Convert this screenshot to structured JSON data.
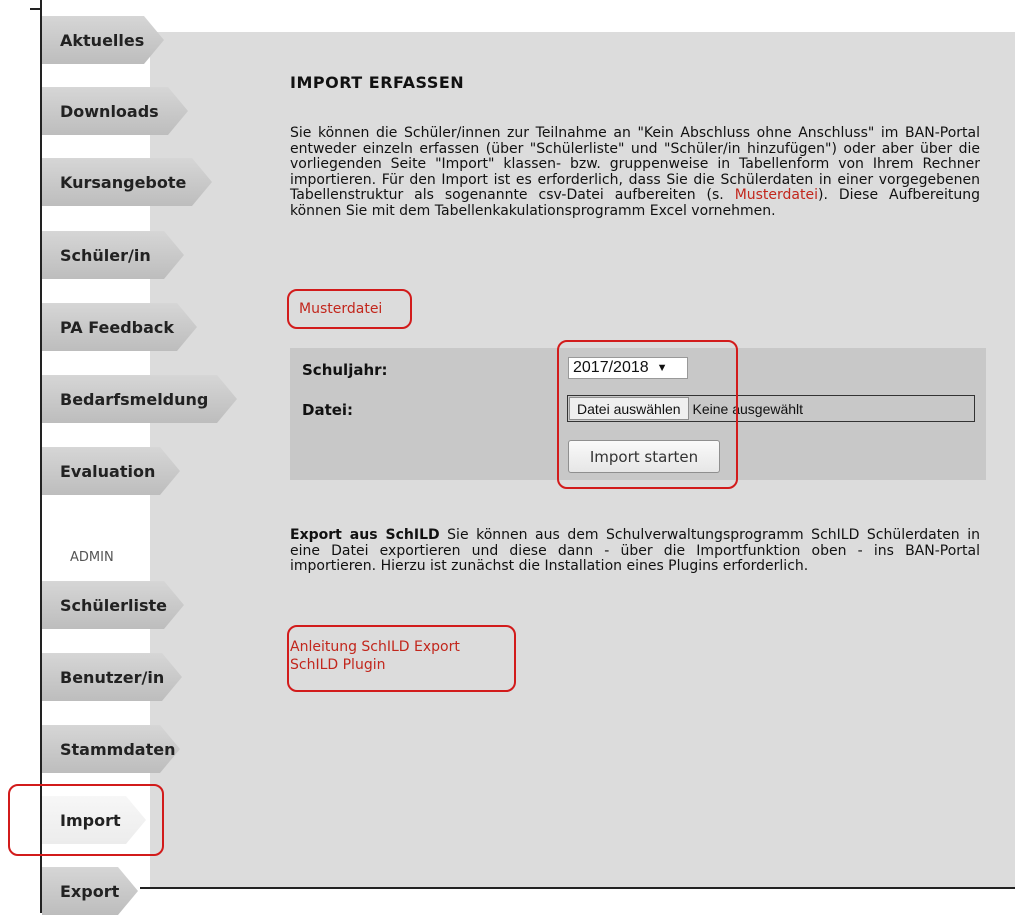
{
  "nav": {
    "items": [
      {
        "label": "Aktuelles"
      },
      {
        "label": "Downloads"
      },
      {
        "label": "Kursangebote"
      },
      {
        "label": "Schüler/in"
      },
      {
        "label": "PA Feedback"
      },
      {
        "label": "Bedarfsmeldung"
      },
      {
        "label": "Evaluation"
      }
    ],
    "admin_heading": "ADMIN",
    "admin_items": [
      {
        "label": "Schülerliste"
      },
      {
        "label": "Benutzer/in"
      },
      {
        "label": "Stammdaten"
      },
      {
        "label": "Import",
        "active": true
      },
      {
        "label": "Export"
      }
    ]
  },
  "main": {
    "title": "IMPORT ERFASSEN",
    "intro_part1": "Sie können die Schüler/innen zur Teilnahme an \"Kein Abschluss ohne Anschluss\" im BAN-Portal entweder einzeln erfassen (über \"Schülerliste\" und \"Schüler/in hinzufügen\") oder aber über die vorliegenden Seite \"Import\" klassen- bzw. gruppenweise in Tabellenform von Ihrem Rechner importieren. Für den Import ist es erforderlich, dass Sie die Schülerdaten in einer vorgegebenen Tabellenstruktur als sogenannte csv-Datei aufbereiten (s. ",
    "intro_link": "Musterdatei",
    "intro_part2": "). Diese Aufbereitung können Sie mit dem Tabellenkakulationsprogramm Excel vornehmen.",
    "musterdatei_link": "Musterdatei",
    "form": {
      "schuljahr_label": "Schuljahr:",
      "schuljahr_value": "2017/2018",
      "datei_label": "Datei:",
      "file_button": "Datei auswählen",
      "file_status": "Keine ausgewählt",
      "submit_label": "Import starten"
    },
    "export_heading": "Export aus SchILD",
    "export_text": " Sie können aus dem Schulverwaltungsprogramm SchILD Schülerdaten in eine Datei exportieren und diese dann - über die Importfunktion oben - ins BAN-Portal importieren. Hierzu ist zunächst die Installation eines Plugins erforderlich.",
    "links": {
      "anleitung": "Anleitung SchILD Export",
      "plugin": "SchILD Plugin"
    }
  },
  "colors": {
    "highlight": "#d21b1b",
    "link": "#c2261c",
    "content_bg": "#dcdcdc",
    "form_bg": "#c8c8c8"
  }
}
